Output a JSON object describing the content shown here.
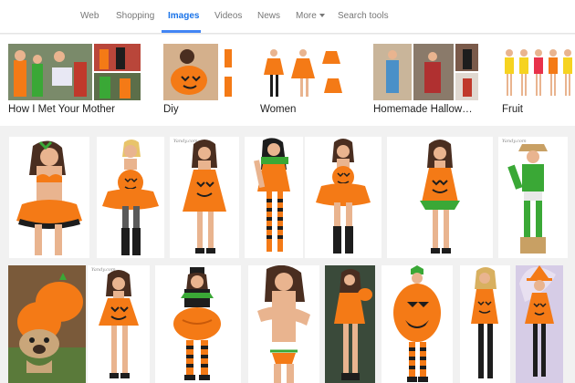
{
  "nav": {
    "tabs": [
      {
        "label": "Web",
        "active": false
      },
      {
        "label": "Shopping",
        "active": false
      },
      {
        "label": "Images",
        "active": true
      },
      {
        "label": "Videos",
        "active": false
      },
      {
        "label": "News",
        "active": false
      },
      {
        "label": "More",
        "active": false
      },
      {
        "label": "Search tools",
        "active": false
      }
    ],
    "accent_color": "#4285f4"
  },
  "related_searches": [
    {
      "label": "How I Met Your Mother"
    },
    {
      "label": "Diy"
    },
    {
      "label": "Women"
    },
    {
      "label": "Homemade Hallow…"
    },
    {
      "label": "Fruit"
    }
  ],
  "results": {
    "row1": [
      {
        "subject": "woman in pumpkin bikini costume"
      },
      {
        "subject": "woman in orange pumpkin tutu dress"
      },
      {
        "subject": "woman in pumpkin skater dress"
      },
      {
        "subject": "woman in pumpkin dress with striped stockings"
      },
      {
        "subject": "woman in pumpkin tutu with black boots"
      },
      {
        "subject": "woman in orange pumpkin mini dress"
      },
      {
        "subject": "woman in green scarecrow costume"
      }
    ],
    "row2": [
      {
        "subject": "pug dog in pumpkin costume"
      },
      {
        "subject": "woman in orange pumpkin dress"
      },
      {
        "subject": "woman in round pumpkin costume"
      },
      {
        "subject": "woman in pumpkin bikini"
      },
      {
        "subject": "woman in pumpkin dress holding pumpkin"
      },
      {
        "subject": "woman in jack-o-lantern tunic"
      },
      {
        "subject": "woman in pumpkin dress with black stockings"
      },
      {
        "subject": "woman in witch pumpkin costume"
      }
    ],
    "watermark": "Yandy.com"
  },
  "palette": {
    "orange": "#f47a16",
    "green": "#3aa836",
    "skin": "#e9b48f",
    "hair": "#4a2e20",
    "black": "#1d1d1d"
  }
}
